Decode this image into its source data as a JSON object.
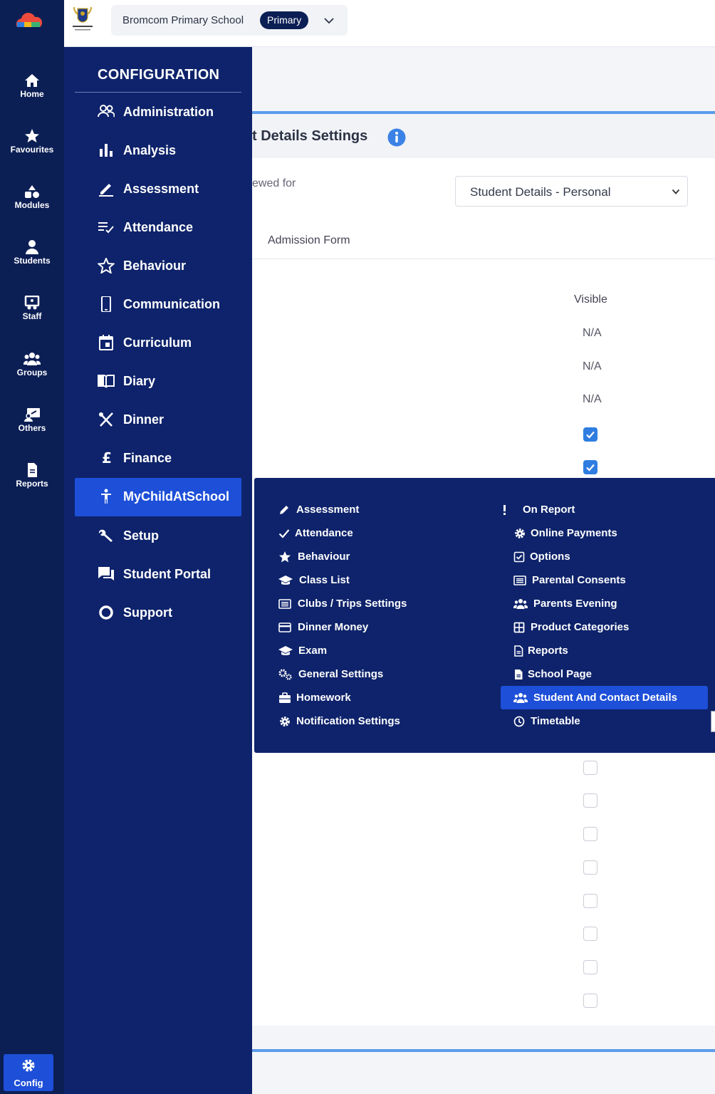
{
  "rail": {
    "items": [
      {
        "label": "Home",
        "icon": "home-icon"
      },
      {
        "label": "Favourites",
        "icon": "star-icon"
      },
      {
        "label": "Modules",
        "icon": "modules-icon"
      },
      {
        "label": "Students",
        "icon": "person-icon"
      },
      {
        "label": "Staff",
        "icon": "staff-icon"
      },
      {
        "label": "Groups",
        "icon": "groups-icon"
      },
      {
        "label": "Others",
        "icon": "others-icon"
      },
      {
        "label": "Reports",
        "icon": "document-icon"
      }
    ],
    "config_label": "Config"
  },
  "topbar": {
    "school_name": "Bromcom Primary School",
    "school_badge": "Primary"
  },
  "content": {
    "title": "t Details Settings",
    "viewed_for_label": "ewed for",
    "selected_view": "Student Details - Personal",
    "tab_label": "Admission Form",
    "column_header": "Visible",
    "rows": [
      "N/A",
      "N/A",
      "N/A",
      "checked",
      "checked",
      "unchecked",
      "unchecked",
      "unchecked",
      "unchecked",
      "unchecked",
      "unchecked",
      "unchecked",
      "unchecked"
    ]
  },
  "config_menu": {
    "title": "CONFIGURATION",
    "items": [
      {
        "label": "Administration",
        "icon": "users-icon"
      },
      {
        "label": "Analysis",
        "icon": "bar-chart-icon"
      },
      {
        "label": "Assessment",
        "icon": "pen-icon"
      },
      {
        "label": "Attendance",
        "icon": "checklist-icon"
      },
      {
        "label": "Behaviour",
        "icon": "star-outline-icon"
      },
      {
        "label": "Communication",
        "icon": "phone-icon"
      },
      {
        "label": "Curriculum",
        "icon": "calendar-icon"
      },
      {
        "label": "Diary",
        "icon": "book-icon"
      },
      {
        "label": "Dinner",
        "icon": "cutlery-icon"
      },
      {
        "label": "Finance",
        "icon": "pound-icon"
      },
      {
        "label": "MyChildAtSchool",
        "icon": "child-icon"
      },
      {
        "label": "Setup",
        "icon": "wrench-icon"
      },
      {
        "label": "Student Portal",
        "icon": "chat-icon"
      },
      {
        "label": "Support",
        "icon": "ring-icon"
      }
    ],
    "active": "MyChildAtSchool"
  },
  "submenu": {
    "left": [
      {
        "label": "Assessment",
        "icon": "pencil-icon"
      },
      {
        "label": "Attendance",
        "icon": "check-icon"
      },
      {
        "label": "Behaviour",
        "icon": "star-icon"
      },
      {
        "label": "Class List",
        "icon": "graduation-cap-icon"
      },
      {
        "label": "Clubs / Trips Settings",
        "icon": "list-icon"
      },
      {
        "label": "Dinner Money",
        "icon": "card-icon"
      },
      {
        "label": "Exam",
        "icon": "graduation-cap-icon"
      },
      {
        "label": "General Settings",
        "icon": "gears-icon"
      },
      {
        "label": "Homework",
        "icon": "briefcase-icon"
      },
      {
        "label": "Notification Settings",
        "icon": "gear-icon"
      }
    ],
    "right": [
      {
        "label": "On Report",
        "icon": "exclamation-icon"
      },
      {
        "label": "Online Payments",
        "icon": "gear-icon"
      },
      {
        "label": "Options",
        "icon": "check-square-icon"
      },
      {
        "label": "Parental Consents",
        "icon": "list-icon"
      },
      {
        "label": "Parents Evening",
        "icon": "users-icon"
      },
      {
        "label": "Product Categories",
        "icon": "grid-icon"
      },
      {
        "label": "Reports",
        "icon": "file-icon"
      },
      {
        "label": "School Page",
        "icon": "file-filled-icon"
      },
      {
        "label": "Student And Contact Details",
        "icon": "users-icon"
      },
      {
        "label": "Timetable",
        "icon": "clock-icon"
      }
    ],
    "active": "Student And Contact Details"
  }
}
